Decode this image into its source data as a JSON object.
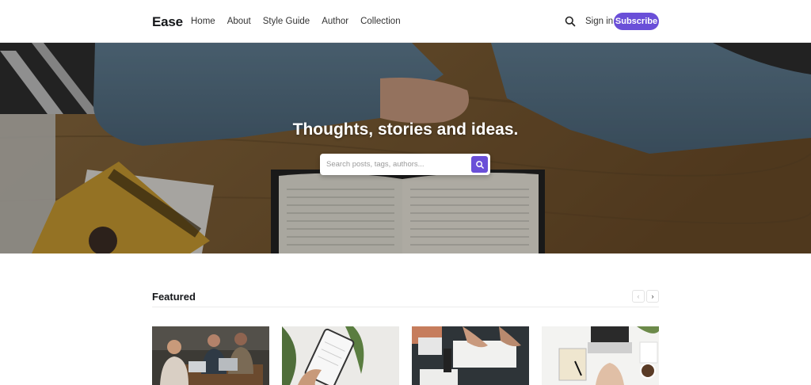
{
  "header": {
    "logo": "Ease",
    "nav": [
      "Home",
      "About",
      "Style Guide",
      "Author",
      "Collection"
    ],
    "signin_label": "Sign in",
    "subscribe_label": "Subscribe",
    "accent_color": "#6a4fd8"
  },
  "hero": {
    "title": "Thoughts, stories and ideas.",
    "search_placeholder": "Search posts, tags, authors..."
  },
  "featured": {
    "title": "Featured",
    "prev_icon": "chevron-left-icon",
    "next_icon": "chevron-right-icon",
    "cards": [
      {
        "image": "people-meeting-laptops"
      },
      {
        "image": "hand-holding-tablet-plant"
      },
      {
        "image": "desk-papers-clipboard"
      },
      {
        "image": "laptop-notebook-coffee"
      }
    ]
  },
  "icons": {
    "search": "search-icon"
  }
}
